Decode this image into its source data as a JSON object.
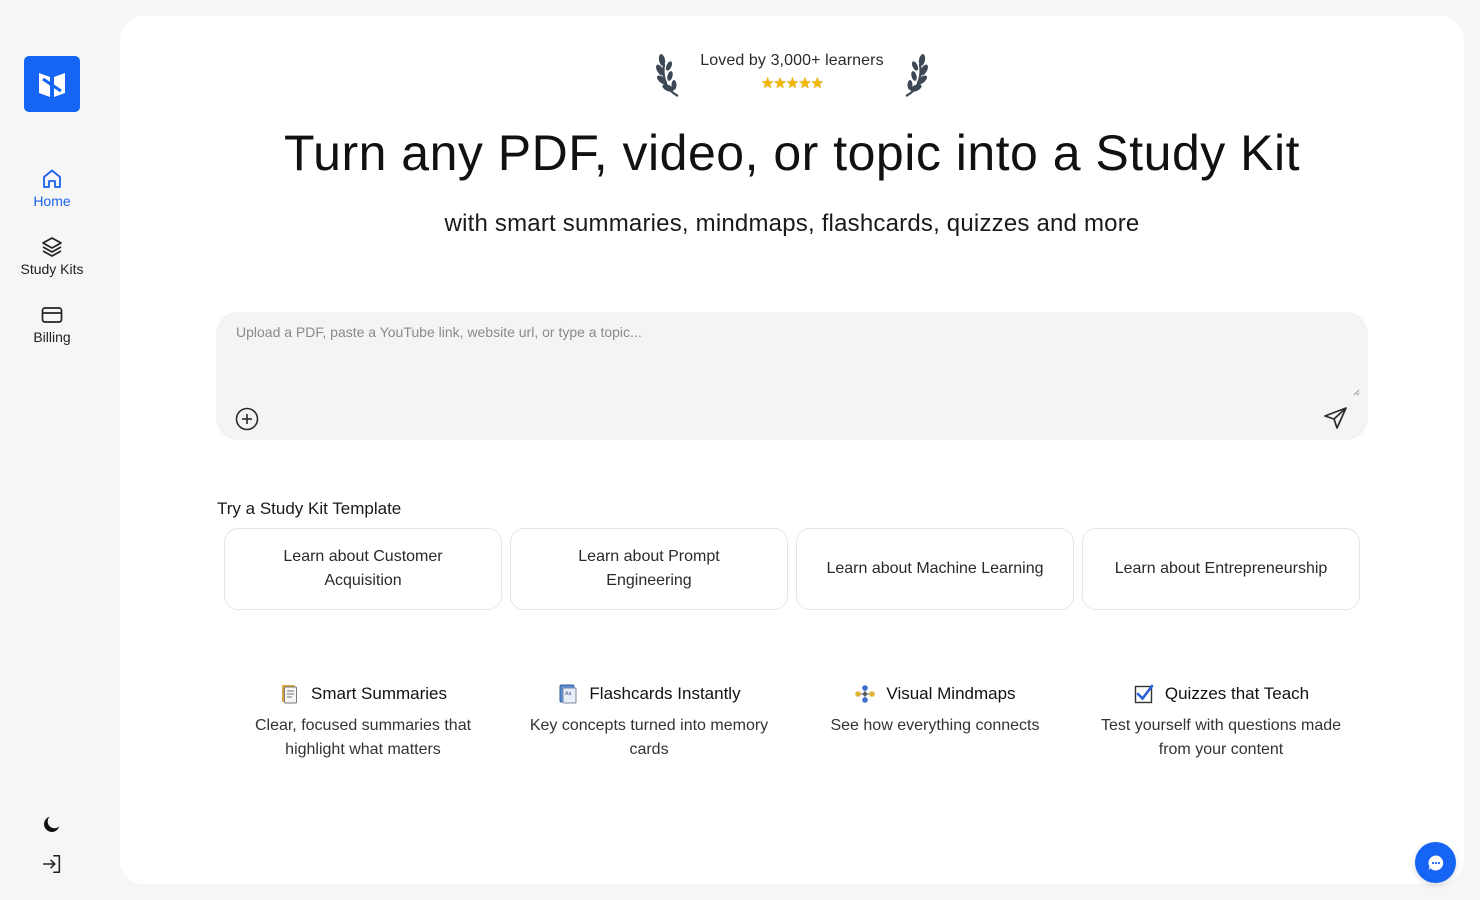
{
  "sidebar": {
    "items": [
      {
        "label": "Home",
        "icon": "home-icon",
        "active": true
      },
      {
        "label": "Study Kits",
        "icon": "layers-icon",
        "active": false
      },
      {
        "label": "Billing",
        "icon": "credit-card-icon",
        "active": false
      }
    ],
    "bottom_icons": [
      "moon-icon",
      "sign-in-icon"
    ]
  },
  "hero": {
    "badge_text": "Loved by 3,000+ learners",
    "stars": "★★★★★",
    "rating": 5,
    "title": "Turn any PDF, video, or topic into a Study Kit",
    "subtitle": "with smart summaries, mindmaps, flashcards, quizzes and more"
  },
  "input": {
    "placeholder": "Upload a PDF, paste a YouTube link, website url, or type a topic...",
    "value": ""
  },
  "templates": {
    "title": "Try a Study Kit Template",
    "items": [
      "Learn about Customer Acquisition",
      "Learn about Prompt Engineering",
      "Learn about Machine Learning",
      "Learn about Entrepreneurship"
    ]
  },
  "features": [
    {
      "title": "Smart Summaries",
      "desc": "Clear, focused summaries that highlight what matters",
      "icon": "document-icon"
    },
    {
      "title": "Flashcards Instantly",
      "desc": "Key concepts turned into memory cards",
      "icon": "flashcard-icon"
    },
    {
      "title": "Visual Mindmaps",
      "desc": "See how everything connects",
      "icon": "mindmap-icon"
    },
    {
      "title": "Quizzes that Teach",
      "desc": "Test yourself with questions made from your content",
      "icon": "checkbox-icon"
    }
  ],
  "colors": {
    "accent": "#1664f4",
    "active_nav": "#1a62e8",
    "background": "#f6f6f6",
    "card": "#ffffff"
  }
}
